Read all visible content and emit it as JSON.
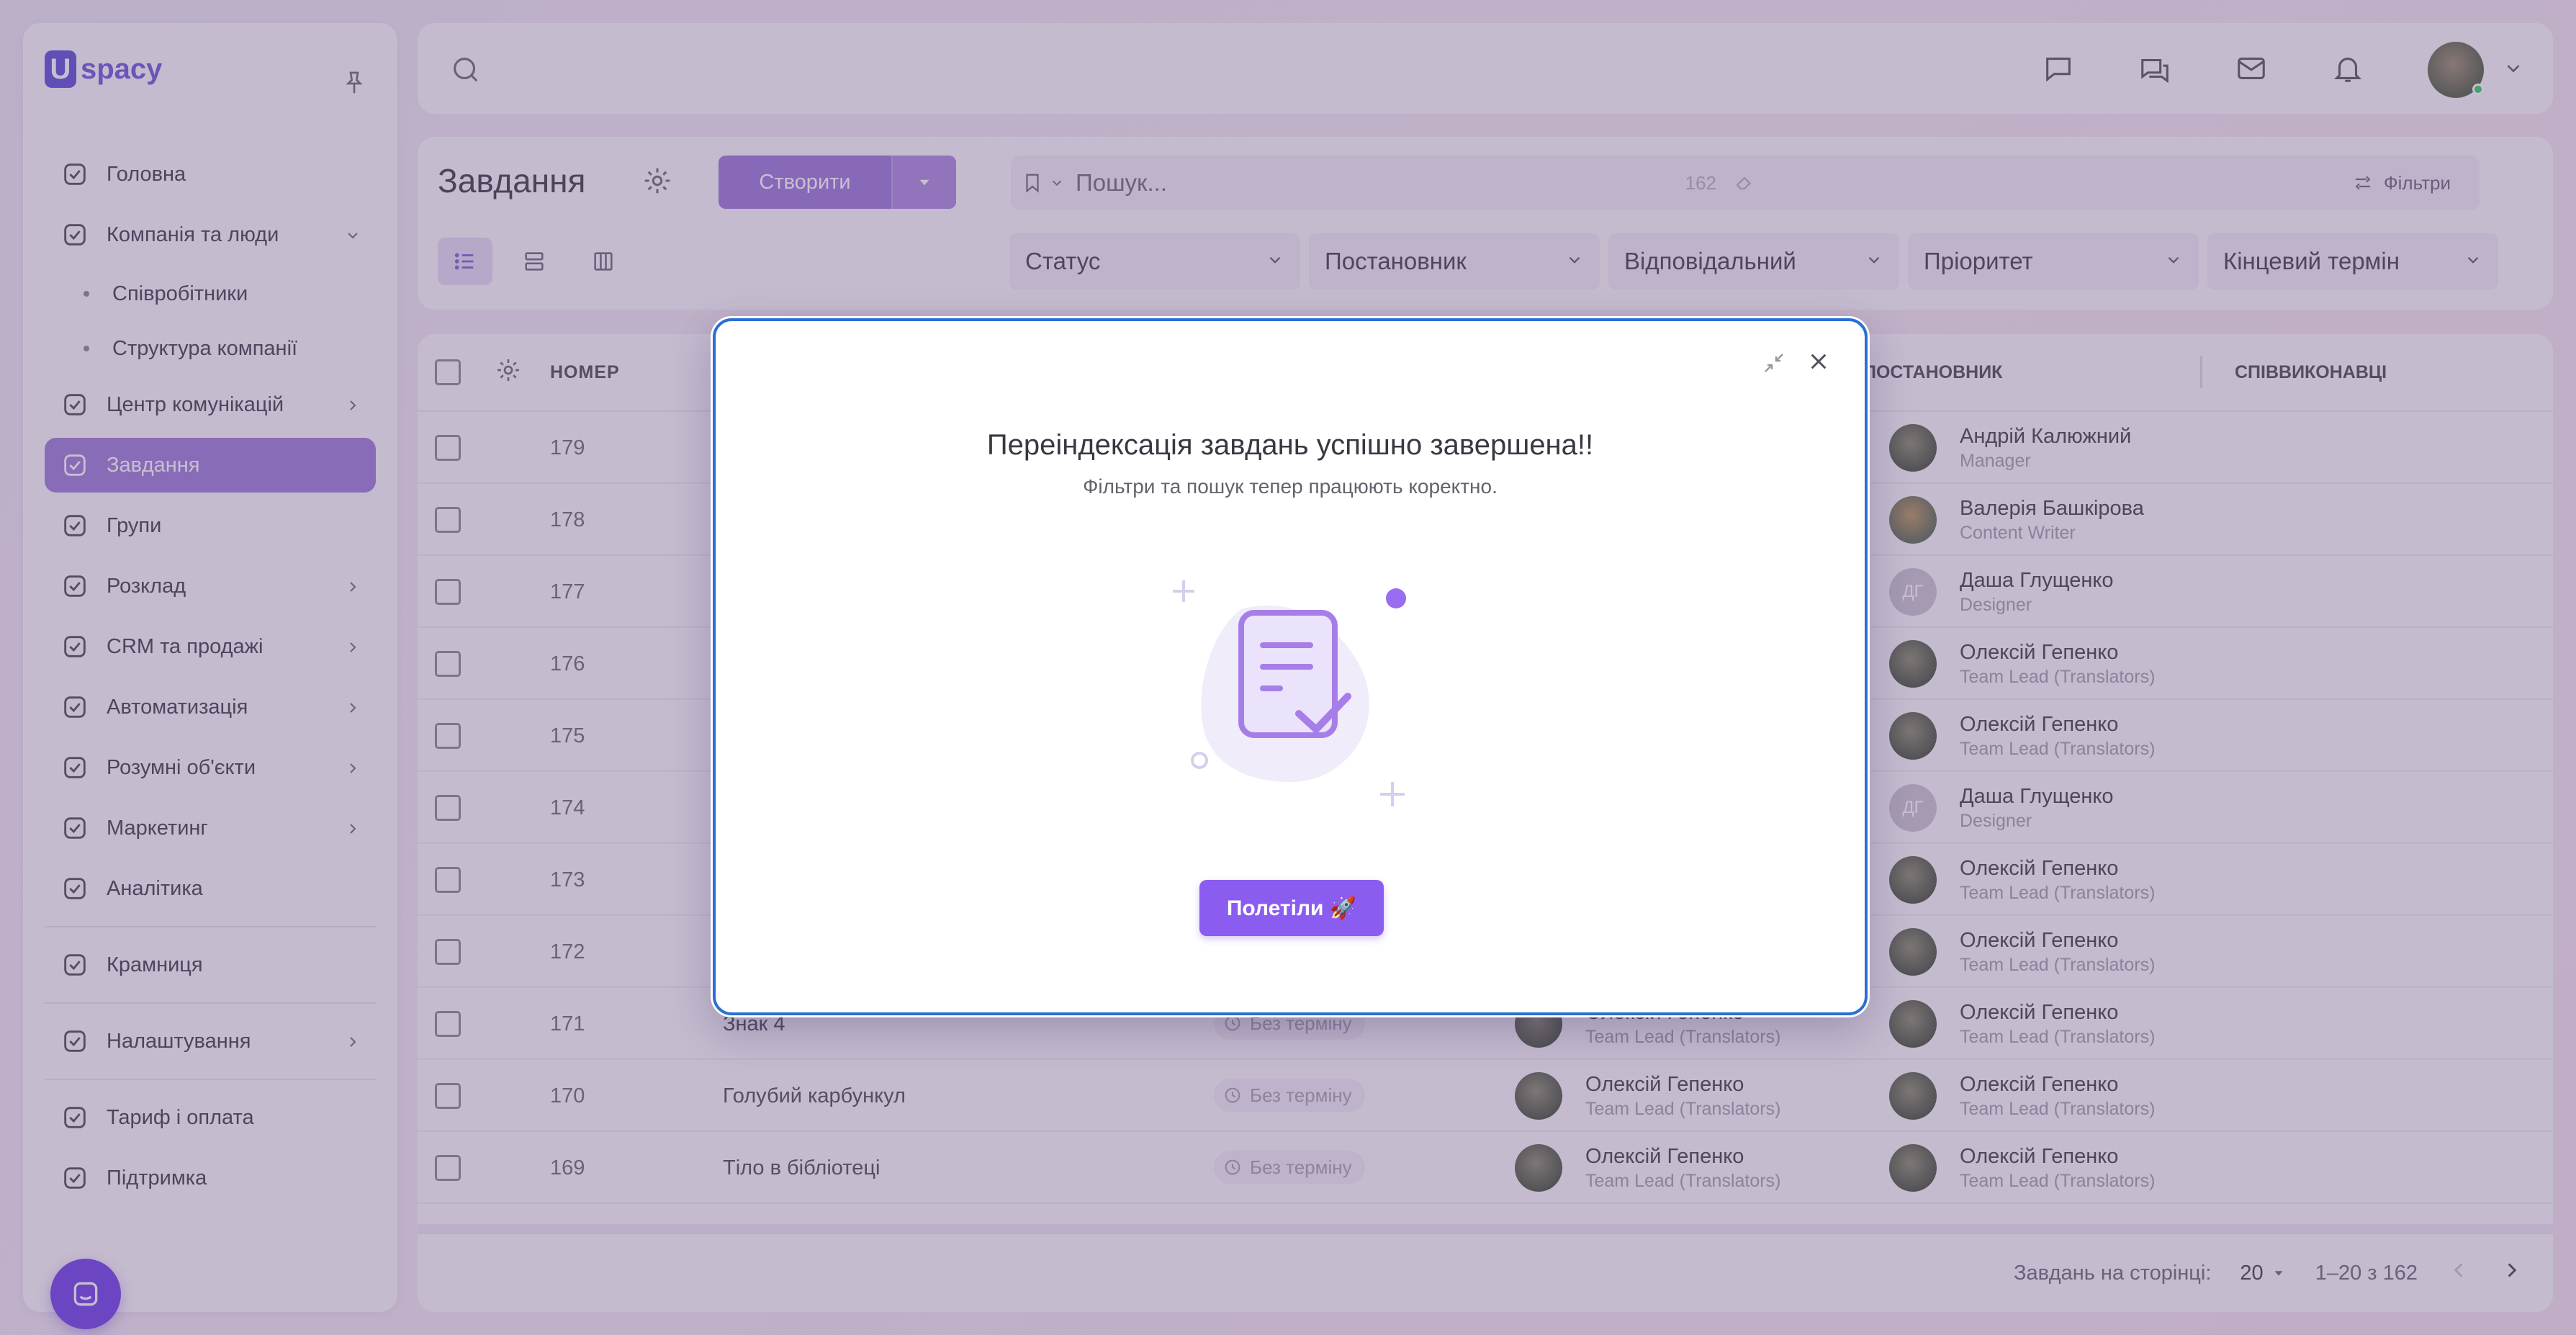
{
  "app": {
    "logo_letter": "U",
    "logo_text": "spacy"
  },
  "sidebar": {
    "items": [
      {
        "label": "Головна",
        "icon": "home-icon"
      },
      {
        "label": "Компанія та люди",
        "icon": "company-icon",
        "expanded": true
      },
      {
        "label": "Співробітники",
        "sub": true
      },
      {
        "label": "Структура компанії",
        "sub": true
      },
      {
        "label": "Центр комунікацій",
        "icon": "communication-icon"
      },
      {
        "label": "Завдання",
        "icon": "tasks-icon",
        "active": true
      },
      {
        "label": "Групи",
        "icon": "groups-icon"
      },
      {
        "label": "Розклад",
        "icon": "calendar-icon"
      },
      {
        "label": "CRM та продажі",
        "icon": "crm-icon"
      },
      {
        "label": "Автоматизація",
        "icon": "automation-icon"
      },
      {
        "label": "Розумні об'єкти",
        "icon": "smart-objects-icon"
      },
      {
        "label": "Маркетинг",
        "icon": "marketing-icon"
      },
      {
        "label": "Аналітика",
        "icon": "analytics-icon"
      },
      {
        "label": "Крамниця",
        "icon": "store-icon"
      },
      {
        "label": "Налаштування",
        "icon": "settings-icon"
      },
      {
        "label": "Тариф і оплата",
        "icon": "billing-icon"
      },
      {
        "label": "Підтримка",
        "icon": "support-icon"
      }
    ]
  },
  "header": {
    "title": "Завдання",
    "create_label": "Створити",
    "search_placeholder": "Пошук...",
    "search_count": "162",
    "filters_label": "Фільтри",
    "dropdowns": [
      "Статус",
      "Постановник",
      "Відповідальний",
      "Пріоритет",
      "Кінцевий термін"
    ]
  },
  "table": {
    "columns": {
      "number": "НОМЕР",
      "author": "ПОСТАНОВНИК",
      "coexecutors": "СПІВВИКОНАВЦІ"
    },
    "due_none": "Без терміну",
    "rows": [
      {
        "num": "179",
        "name": "",
        "author": {
          "name": "Андрій Калюжний",
          "role": "Manager"
        }
      },
      {
        "num": "178",
        "name": "",
        "author": {
          "name": "Валерія Башкірова",
          "role": "Content Writer"
        }
      },
      {
        "num": "177",
        "name": "",
        "author": {
          "name": "Даша Глущенко",
          "role": "Designer",
          "initials": "ДГ"
        }
      },
      {
        "num": "176",
        "name": "",
        "author": {
          "name": "Олексій Гепенко",
          "role": "Team Lead (Translators)"
        }
      },
      {
        "num": "175",
        "name": "",
        "author": {
          "name": "Олексій Гепенко",
          "role": "Team Lead (Translators)"
        }
      },
      {
        "num": "174",
        "name": "",
        "author": {
          "name": "Даша Глущенко",
          "role": "Designer",
          "initials": "ДГ"
        }
      },
      {
        "num": "173",
        "name": "",
        "author": {
          "name": "Олексій Гепенко",
          "role": "Team Lead (Translators)"
        }
      },
      {
        "num": "172",
        "name": "",
        "author": {
          "name": "Олексій Гепенко",
          "role": "Team Lead (Translators)"
        }
      },
      {
        "num": "171",
        "name": "Знак 4",
        "resp": {
          "name": "Олексій Гепенко",
          "role": "Team Lead (Translators)"
        },
        "author": {
          "name": "Олексій Гепенко",
          "role": "Team Lead (Translators)"
        }
      },
      {
        "num": "170",
        "name": "Голубий карбункул",
        "resp": {
          "name": "Олексій Гепенко",
          "role": "Team Lead (Translators)"
        },
        "author": {
          "name": "Олексій Гепенко",
          "role": "Team Lead (Translators)"
        }
      },
      {
        "num": "169",
        "name": "Тіло в бібліотеці",
        "resp": {
          "name": "Олексій Гепенко",
          "role": "Team Lead (Translators)"
        },
        "author": {
          "name": "Олексій Гепенко",
          "role": "Team Lead (Translators)"
        }
      }
    ],
    "footer": {
      "per_page_label": "Завдань на сторінці:",
      "per_page": "20",
      "range": "1–20 з 162"
    }
  },
  "modal": {
    "title": "Переіндексація завдань успішно завершена!!",
    "subtitle": "Фільтри та пошук тепер працюють коректно.",
    "button_label": "Полетіли 🚀"
  },
  "colors": {
    "accent": "#8b5cf0",
    "modal_border": "#2a6fd4"
  }
}
